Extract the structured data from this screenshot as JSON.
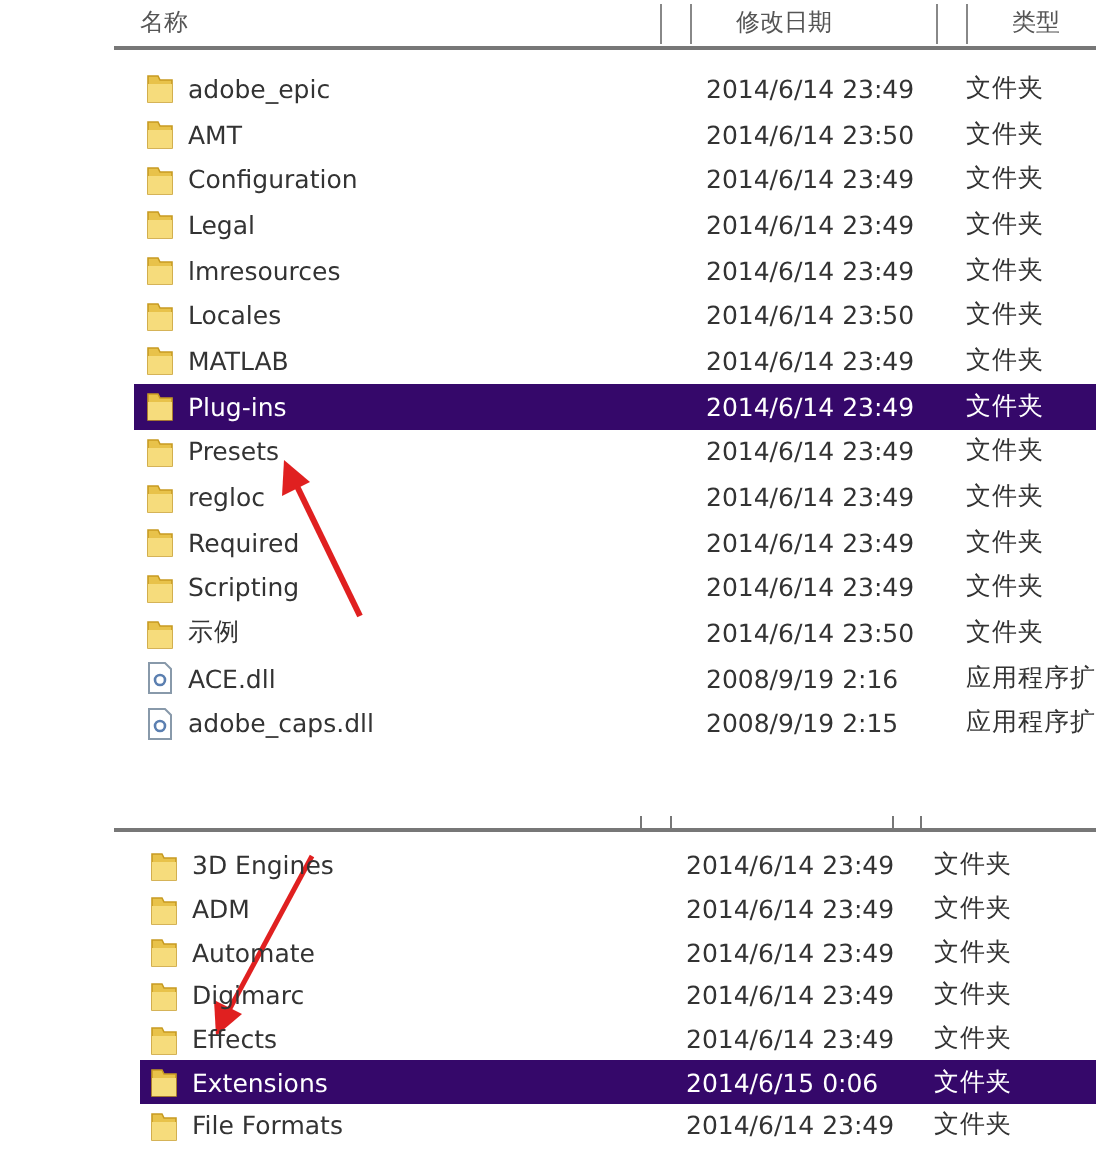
{
  "top_panel": {
    "columns": [
      "名称",
      "修改日期",
      "类型"
    ],
    "rows": [
      {
        "kind": "folder",
        "name": "adobe_epic",
        "modified": "2014/6/14 23:49",
        "type": "文件夹",
        "selected": false
      },
      {
        "kind": "folder",
        "name": "AMT",
        "modified": "2014/6/14 23:50",
        "type": "文件夹",
        "selected": false
      },
      {
        "kind": "folder",
        "name": "Configuration",
        "modified": "2014/6/14 23:49",
        "type": "文件夹",
        "selected": false
      },
      {
        "kind": "folder",
        "name": "Legal",
        "modified": "2014/6/14 23:49",
        "type": "文件夹",
        "selected": false
      },
      {
        "kind": "folder",
        "name": "lmresources",
        "modified": "2014/6/14 23:49",
        "type": "文件夹",
        "selected": false
      },
      {
        "kind": "folder",
        "name": "Locales",
        "modified": "2014/6/14 23:50",
        "type": "文件夹",
        "selected": false
      },
      {
        "kind": "folder",
        "name": "MATLAB",
        "modified": "2014/6/14 23:49",
        "type": "文件夹",
        "selected": false
      },
      {
        "kind": "folder",
        "name": "Plug-ins",
        "modified": "2014/6/14 23:49",
        "type": "文件夹",
        "selected": true
      },
      {
        "kind": "folder",
        "name": "Presets",
        "modified": "2014/6/14 23:49",
        "type": "文件夹",
        "selected": false
      },
      {
        "kind": "folder",
        "name": "regloc",
        "modified": "2014/6/14 23:49",
        "type": "文件夹",
        "selected": false
      },
      {
        "kind": "folder",
        "name": "Required",
        "modified": "2014/6/14 23:49",
        "type": "文件夹",
        "selected": false
      },
      {
        "kind": "folder",
        "name": "Scripting",
        "modified": "2014/6/14 23:49",
        "type": "文件夹",
        "selected": false
      },
      {
        "kind": "folder",
        "name": "示例",
        "modified": "2014/6/14 23:50",
        "type": "文件夹",
        "selected": false
      },
      {
        "kind": "dll",
        "name": "ACE.dll",
        "modified": "2008/9/19 2:16",
        "type": "应用程序扩",
        "selected": false
      },
      {
        "kind": "dll",
        "name": "adobe_caps.dll",
        "modified": "2008/9/19 2:15",
        "type": "应用程序扩",
        "selected": false
      }
    ]
  },
  "bottom_panel": {
    "rows": [
      {
        "kind": "folder",
        "name": "3D Engines",
        "modified": "2014/6/14 23:49",
        "type": "文件夹",
        "selected": false
      },
      {
        "kind": "folder",
        "name": "ADM",
        "modified": "2014/6/14 23:49",
        "type": "文件夹",
        "selected": false
      },
      {
        "kind": "folder",
        "name": "Automate",
        "modified": "2014/6/14 23:49",
        "type": "文件夹",
        "selected": false
      },
      {
        "kind": "folder",
        "name": "Digimarc",
        "modified": "2014/6/14 23:49",
        "type": "文件夹",
        "selected": false
      },
      {
        "kind": "folder",
        "name": "Effects",
        "modified": "2014/6/14 23:49",
        "type": "文件夹",
        "selected": false
      },
      {
        "kind": "folder",
        "name": "Extensions",
        "modified": "2014/6/15 0:06",
        "type": "文件夹",
        "selected": true
      },
      {
        "kind": "folder",
        "name": "File Formats",
        "modified": "2014/6/14 23:49",
        "type": "文件夹",
        "selected": false
      }
    ]
  }
}
